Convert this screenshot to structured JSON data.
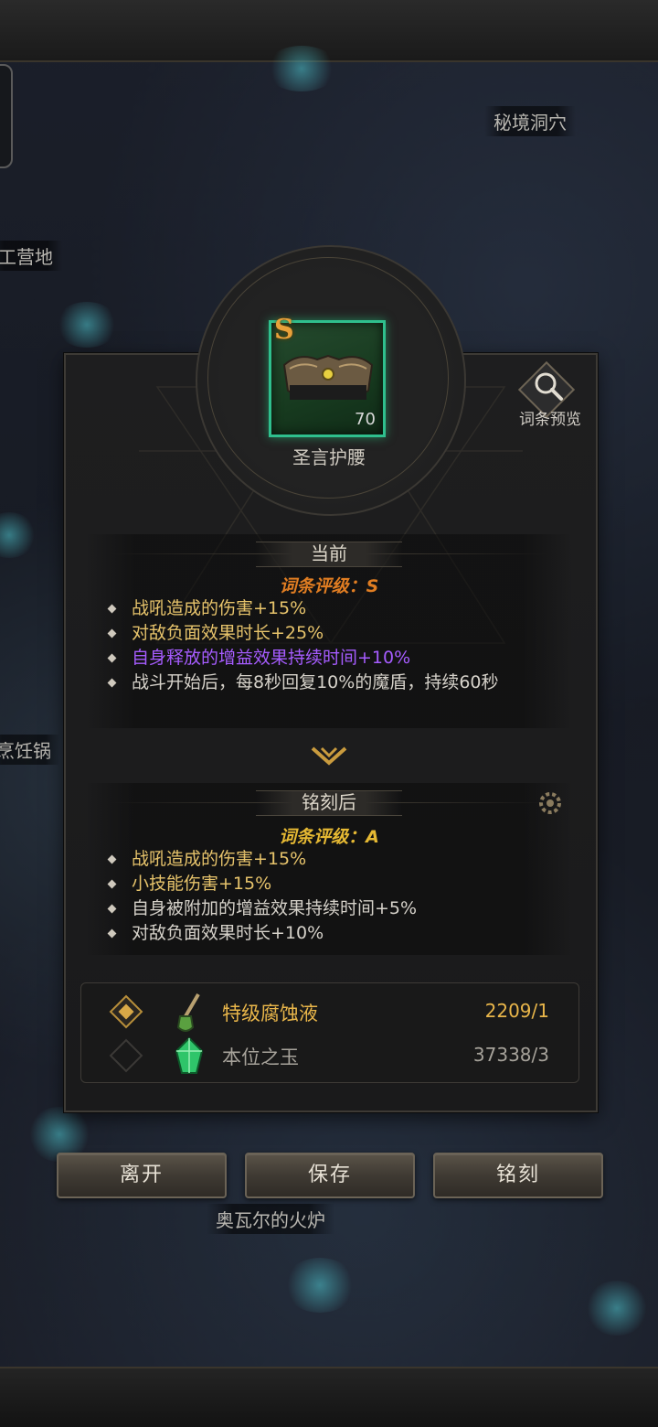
{
  "map_labels": {
    "secret_cave": "秘境洞穴",
    "camp": "工营地",
    "cook_pot": "烹饪锅",
    "furnace": "奥瓦尔的火炉"
  },
  "item": {
    "grade": "S",
    "level": "70",
    "name": "圣言护腰",
    "icon": "belt-icon"
  },
  "preview": {
    "label": "词条预览",
    "icon": "magnifier-icon"
  },
  "current": {
    "title": "当前",
    "rating": "词条评级：S",
    "affixes": [
      {
        "text": "战吼造成的伤害+15%",
        "color": "#e6c36b"
      },
      {
        "text": "对敌负面效果时长+25%",
        "color": "#e6c36b"
      },
      {
        "text": "自身释放的增益效果持续时间+10%",
        "color": "#a65cff"
      },
      {
        "text": "战斗开始后，每8秒回复10%的魔盾，持续60秒",
        "color": "#d6d2ca"
      }
    ]
  },
  "after": {
    "title": "铭刻后",
    "rating": "词条评级：A",
    "affixes": [
      {
        "text": "战吼造成的伤害+15%",
        "color": "#e6c36b"
      },
      {
        "text": "小技能伤害+15%",
        "color": "#e6c36b"
      },
      {
        "text": "自身被附加的增益效果持续时间+5%",
        "color": "#d6d2ca"
      },
      {
        "text": "对敌负面效果时长+10%",
        "color": "#d6d2ca"
      }
    ]
  },
  "materials": [
    {
      "name": "特级腐蚀液",
      "count": "2209/1",
      "selected": true,
      "name_color": "#e9b64a",
      "count_color": "#e9b64a",
      "icon": "corrosive-potion-icon"
    },
    {
      "name": "本位之玉",
      "count": "37338/3",
      "selected": false,
      "name_color": "#a6a29a",
      "count_color": "#a6a29a",
      "icon": "green-jade-icon"
    }
  ],
  "buttons": {
    "leave": "离开",
    "save": "保存",
    "engrave": "铭刻"
  },
  "colors": {
    "rarity_frame": "#2fbf8d",
    "gold_text": "#e6c36b",
    "purple_text": "#a65cff",
    "orange_rating": "#e07d22"
  }
}
